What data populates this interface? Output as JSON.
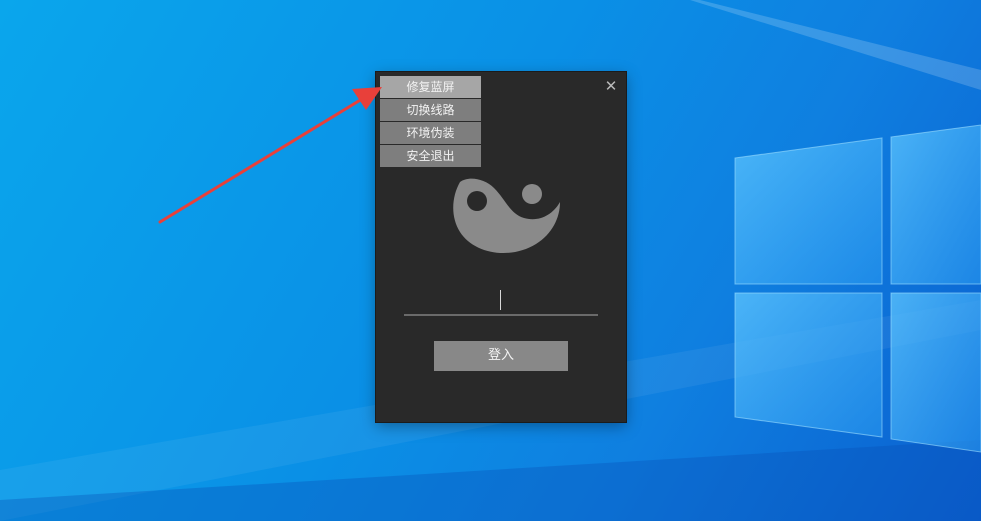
{
  "colors": {
    "desktop_background": "#0a90e6",
    "window_background": "#292929",
    "menu_item": "#7e7e7e",
    "menu_item_active": "#a6a6a6",
    "login_button": "#888888",
    "logo": "#8a8a8a",
    "annotation_arrow": "#e8403a"
  },
  "window": {
    "close_glyph": "✕",
    "menu": {
      "items": [
        {
          "label": "修复蓝屏",
          "active": true
        },
        {
          "label": "切换线路",
          "active": false
        },
        {
          "label": "环境伪装",
          "active": false
        },
        {
          "label": "安全退出",
          "active": false
        }
      ]
    },
    "logo_icon": "taiji-yin-yang-icon",
    "password": {
      "value": "",
      "placeholder": ""
    },
    "login_label": "登入"
  },
  "annotation": {
    "icon": "red-arrow-icon"
  }
}
